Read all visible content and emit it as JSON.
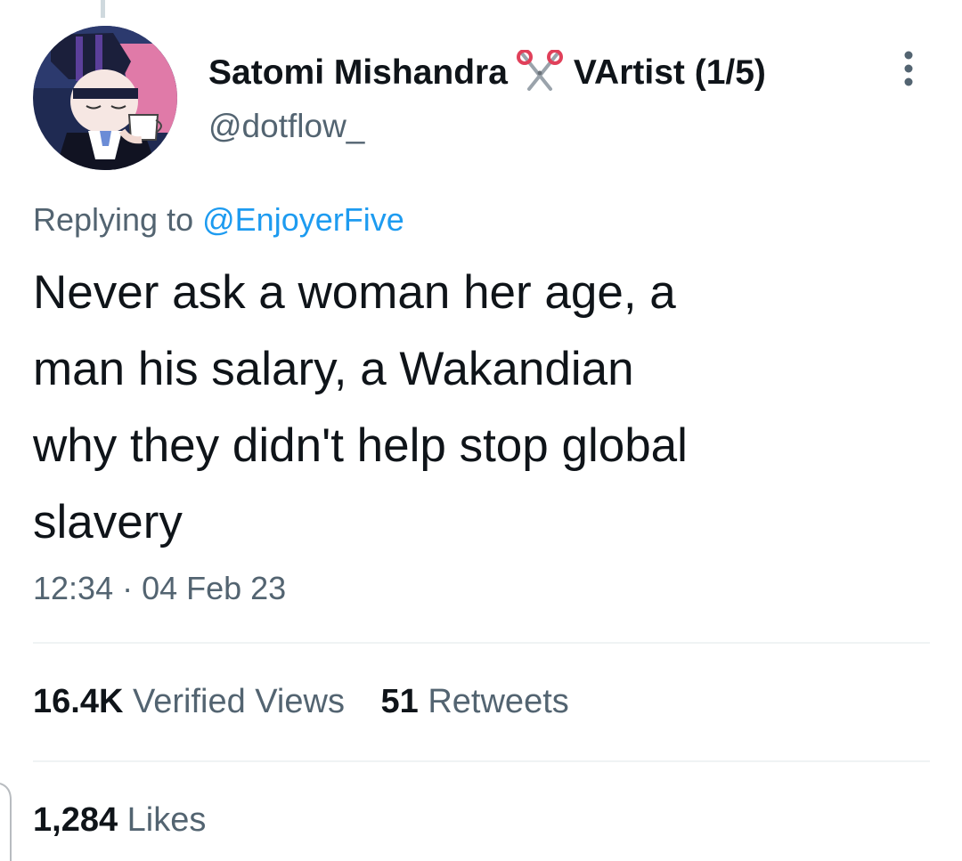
{
  "tweet": {
    "author": {
      "display_name": "Satomi Mishandra",
      "name_emoji_icon": "scissors-icon",
      "name_suffix": "VArtist (1/5)",
      "handle": "@dotflow_"
    },
    "more_icon": "more-options-icon",
    "replying_to_prefix": "Replying to",
    "replying_to_handle": "@EnjoyerFive",
    "text_lines": [
      "Never ask a woman her age, a",
      "man his salary, a Wakandian",
      "why they didn't help stop global",
      "slavery"
    ],
    "timestamp": "12:34 · 04 Feb 23",
    "views": {
      "count": "16.4K",
      "label": "Verified Views"
    },
    "retweets": {
      "count": "51",
      "label": "Retweets"
    },
    "likes": {
      "count": "1,284",
      "label": "Likes"
    }
  },
  "colors": {
    "text_primary": "#0f1419",
    "text_secondary": "#536471",
    "link": "#1d9bf0",
    "divider": "#eff3f4"
  }
}
